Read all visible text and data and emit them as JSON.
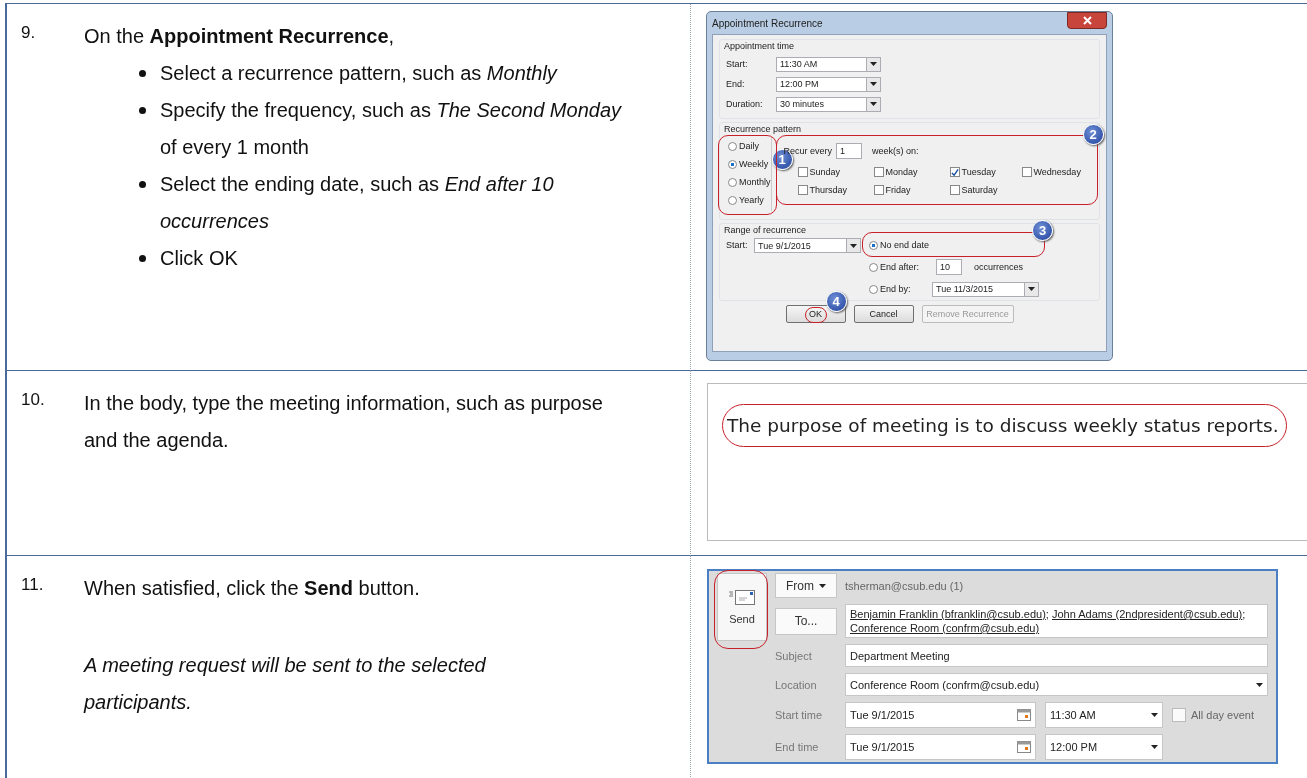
{
  "steps": [
    {
      "number": "9.",
      "text": "On the **Appointment Recurrence**,",
      "bullets": [
        "Select a recurrence pattern, such as *Monthly*",
        "Specify the frequency, such as *The Second Monday* of every 1 month",
        "Select the ending date, such as *End after 10 occurrences*",
        "Click OK"
      ],
      "figure": {
        "kind": "recurrence-dialog",
        "title": "Appointment Recurrence",
        "appointment_time": {
          "label": "Appointment time",
          "fields": [
            {
              "label": "Start:",
              "value": "11:30 AM"
            },
            {
              "label": "End:",
              "value": "12:00 PM"
            },
            {
              "label": "Duration:",
              "value": "30 minutes"
            }
          ]
        },
        "pattern": {
          "label": "Recurrence pattern",
          "options": [
            {
              "label": "Daily",
              "selected": false
            },
            {
              "label": "Weekly",
              "selected": true
            },
            {
              "label": "Monthly",
              "selected": false
            },
            {
              "label": "Yearly",
              "selected": false
            }
          ],
          "recur_label": "Recur every",
          "recur_value": "1",
          "recur_unit": "week(s) on:",
          "days": [
            {
              "label": "Sunday",
              "checked": false
            },
            {
              "label": "Monday",
              "checked": false
            },
            {
              "label": "Tuesday",
              "checked": true
            },
            {
              "label": "Wednesday",
              "checked": false
            },
            {
              "label": "Thursday",
              "checked": false
            },
            {
              "label": "Friday",
              "checked": false
            },
            {
              "label": "Saturday",
              "checked": false
            }
          ]
        },
        "range": {
          "label": "Range of recurrence",
          "start_label": "Start:",
          "start_value": "Tue 9/1/2015",
          "options": [
            {
              "label": "No end date",
              "selected": true
            },
            {
              "label": "End after:",
              "selected": false,
              "value": "10",
              "suffix": "occurrences"
            },
            {
              "label": "End by:",
              "selected": false,
              "value": "Tue 11/3/2015"
            }
          ]
        },
        "buttons": [
          {
            "label": "OK",
            "disabled": false
          },
          {
            "label": "Cancel",
            "disabled": false
          },
          {
            "label": "Remove Recurrence",
            "disabled": true
          }
        ],
        "callouts": [
          "1",
          "2",
          "3",
          "4"
        ]
      }
    },
    {
      "number": "10.",
      "text": "In the body, type the meeting information, such as purpose and the agenda.",
      "figure": {
        "kind": "body-text",
        "text": "The purpose of meeting is to discuss weekly status reports."
      }
    },
    {
      "number": "11.",
      "text": "When satisfied, click the **Send** button.",
      "note": "A meeting request will be sent to the selected participants.",
      "figure": {
        "kind": "compose-form",
        "send": "Send",
        "from_button": "From",
        "from_value": "tsherman@csub.edu (1)",
        "to_button": "To...",
        "recipients": [
          "Benjamin Franklin (bfranklin@csub.edu)",
          "John Adams (2ndpresident@csub.edu)",
          "Conference Room (confrm@csub.edu)"
        ],
        "recipient_separator": ";",
        "subject_label": "Subject",
        "subject": "Department Meeting",
        "location_label": "Location",
        "location": "Conference Room (confrm@csub.edu)",
        "start_label": "Start time",
        "start_date": "Tue 9/1/2015",
        "start_time": "11:30 AM",
        "all_day_label": "All day event",
        "all_day": false,
        "end_label": "End time",
        "end_date": "Tue 9/1/2015",
        "end_time": "12:00 PM"
      }
    }
  ]
}
